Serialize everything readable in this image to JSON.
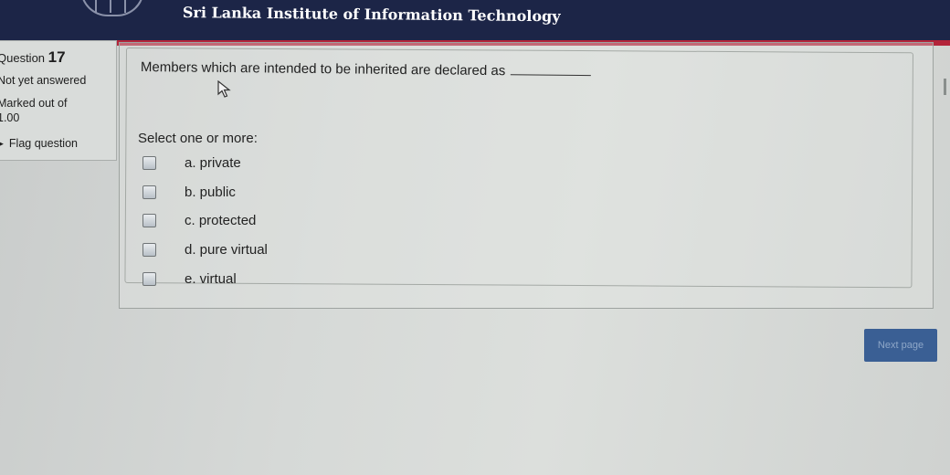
{
  "header": {
    "title": "Sri Lanka Institute of Information Technology"
  },
  "info": {
    "question_prefix": "Question",
    "question_number": "17",
    "state": "Not yet answered",
    "marked_out_of": "Marked out of",
    "marks": "1.00",
    "flag_label": "Flag question"
  },
  "question": {
    "text": "Members which are intended to be inherited are declared as",
    "prompt": "Select one or more:",
    "options": [
      {
        "label": "a. private"
      },
      {
        "label": "b. public"
      },
      {
        "label": "c. protected"
      },
      {
        "label": "d. pure virtual"
      },
      {
        "label": "e. virtual"
      }
    ]
  },
  "navigation": {
    "next_label": "Next page"
  },
  "colors": {
    "header_bg": "#1c2547",
    "header_stripe": "#b3243a",
    "button_bg": "#3a5f94"
  },
  "icons": [
    "university-logo-icon",
    "flag-icon",
    "mouse-cursor-icon",
    "drag-handle-icon"
  ]
}
